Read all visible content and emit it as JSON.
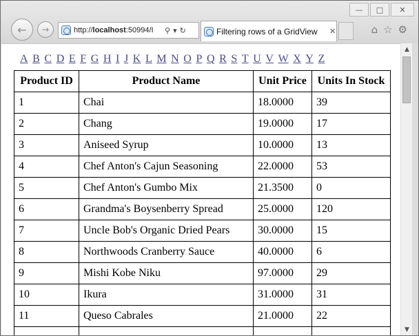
{
  "browser": {
    "url_prefix": "http://",
    "url_host": "localhost",
    "url_rest": ":50994/I",
    "tab_title": "Filtering rows of a GridView",
    "nav_icons": [
      "back-arrow-icon",
      "forward-arrow-icon"
    ],
    "tool_icons": [
      "home-icon",
      "star-icon",
      "gear-icon"
    ]
  },
  "alphabet": [
    "A",
    "B",
    "C",
    "D",
    "E",
    "F",
    "G",
    "H",
    "I",
    "J",
    "K",
    "L",
    "M",
    "N",
    "O",
    "P",
    "Q",
    "R",
    "S",
    "T",
    "U",
    "V",
    "W",
    "X",
    "Y",
    "Z"
  ],
  "grid": {
    "headers": [
      "Product ID",
      "Product Name",
      "Unit Price",
      "Units In Stock"
    ],
    "rows": [
      [
        "1",
        "Chai",
        "18.0000",
        "39"
      ],
      [
        "2",
        "Chang",
        "19.0000",
        "17"
      ],
      [
        "3",
        "Aniseed Syrup",
        "10.0000",
        "13"
      ],
      [
        "4",
        "Chef Anton's Cajun Seasoning",
        "22.0000",
        "53"
      ],
      [
        "5",
        "Chef Anton's Gumbo Mix",
        "21.3500",
        "0"
      ],
      [
        "6",
        "Grandma's Boysenberry Spread",
        "25.0000",
        "120"
      ],
      [
        "7",
        "Uncle Bob's Organic Dried Pears",
        "30.0000",
        "15"
      ],
      [
        "8",
        "Northwoods Cranberry Sauce",
        "40.0000",
        "6"
      ],
      [
        "9",
        "Mishi Kobe Niku",
        "97.0000",
        "29"
      ],
      [
        "10",
        "Ikura",
        "31.0000",
        "31"
      ],
      [
        "11",
        "Queso Cabrales",
        "21.0000",
        "22"
      ],
      [
        "",
        "",
        "",
        ""
      ]
    ]
  },
  "colors": {
    "link": "#4a4a8a",
    "grid_border": "#000000"
  }
}
